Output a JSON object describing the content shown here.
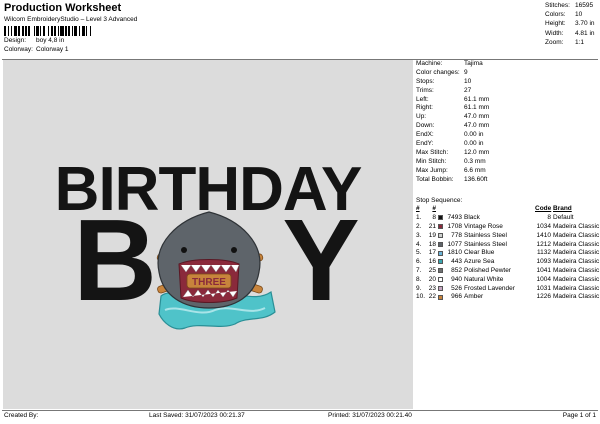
{
  "header": {
    "title": "Production Worksheet",
    "software": "Wilcom EmbroideryStudio – Level 3 Advanced",
    "design_label": "Design:",
    "design_value": "boy 4,8 in",
    "colorway_label": "Colorway:",
    "colorway_value": "Colorway 1"
  },
  "stats": [
    {
      "label": "Stitches:",
      "value": "16595"
    },
    {
      "label": "Colors:",
      "value": "10"
    },
    {
      "label": "Height:",
      "value": "3.70 in"
    },
    {
      "label": "Width:",
      "value": "4.81 in"
    },
    {
      "label": "Zoom:",
      "value": "1:1"
    }
  ],
  "machine_info": [
    {
      "label": "Machine:",
      "value": "Tajima"
    },
    {
      "label": "Color changes:",
      "value": "9"
    },
    {
      "label": "Stops:",
      "value": "10"
    },
    {
      "label": "Trims:",
      "value": "27"
    },
    {
      "label": "Left:",
      "value": "61.1 mm"
    },
    {
      "label": "Right:",
      "value": "61.1 mm"
    },
    {
      "label": "Up:",
      "value": "47.0 mm"
    },
    {
      "label": "Down:",
      "value": "47.0 mm"
    },
    {
      "label": "EndX:",
      "value": "0.00 in"
    },
    {
      "label": "EndY:",
      "value": "0.00 in"
    },
    {
      "label": "Max Stitch:",
      "value": "12.0 mm"
    },
    {
      "label": "Min Stitch:",
      "value": "0.3 mm"
    },
    {
      "label": "Max Jump:",
      "value": "6.6 mm"
    },
    {
      "label": "Total Bobbin:",
      "value": "136.60ft"
    }
  ],
  "stop_sequence_label": "Stop Sequence:",
  "stop_headers": {
    "n": "#",
    "hash": "#",
    "name": "",
    "code": "Code",
    "brand": "Brand"
  },
  "stops": [
    {
      "n": "1.",
      "hash": "8",
      "swatch": "#111111",
      "num": "7493",
      "name": "Black",
      "code": "8",
      "brand": "Default"
    },
    {
      "n": "2.",
      "hash": "21",
      "swatch": "#8a2a3b",
      "num": "1708",
      "name": "Vintage Rose",
      "code": "1034",
      "brand": "Madeira Classic 40"
    },
    {
      "n": "3.",
      "hash": "19",
      "swatch": "#cfd2d0",
      "num": "778",
      "name": "Stainless Steel",
      "code": "1410",
      "brand": "Madeira Classic 40"
    },
    {
      "n": "4.",
      "hash": "18",
      "swatch": "#5e646a",
      "num": "1077",
      "name": "Stainless Steel",
      "code": "1212",
      "brand": "Madeira Classic 40"
    },
    {
      "n": "5.",
      "hash": "17",
      "swatch": "#6ab4d8",
      "num": "1810",
      "name": "Clear Blue",
      "code": "1132",
      "brand": "Madeira Classic 40"
    },
    {
      "n": "6.",
      "hash": "16",
      "swatch": "#3aa6b0",
      "num": "443",
      "name": "Azure Sea",
      "code": "1093",
      "brand": "Madeira Classic 40"
    },
    {
      "n": "7.",
      "hash": "25",
      "swatch": "#6d6f70",
      "num": "852",
      "name": "Polished Pewter",
      "code": "1041",
      "brand": "Madeira Classic 40"
    },
    {
      "n": "8.",
      "hash": "20",
      "swatch": "#ffffff",
      "num": "940",
      "name": "Natural White",
      "code": "1004",
      "brand": "Madeira Classic 40"
    },
    {
      "n": "9.",
      "hash": "23",
      "swatch": "#c7a7c2",
      "num": "526",
      "name": "Frosted Lavender",
      "code": "1031",
      "brand": "Madeira Classic 40"
    },
    {
      "n": "10.",
      "hash": "22",
      "swatch": "#c8843c",
      "num": "966",
      "name": "Amber",
      "code": "1226",
      "brand": "Madeira Classic 40"
    }
  ],
  "design_text": {
    "line1": "BIRTHDAY",
    "line2_left": "B",
    "line2_right": "Y",
    "badge": "THREE"
  },
  "footer": {
    "created_by": "Created By:",
    "last_saved": "Last Saved: 31/07/2023 00:21.37",
    "printed": "Printed: 31/07/2023 00:21.40",
    "page": "Page 1 of 1"
  },
  "colors": {
    "canvas": "#dcdcdc",
    "thread_black": "#111111",
    "rose": "#8a2a3b",
    "amber": "#c8843c",
    "azure": "#3aa6b0",
    "shark": "#5e646a"
  }
}
